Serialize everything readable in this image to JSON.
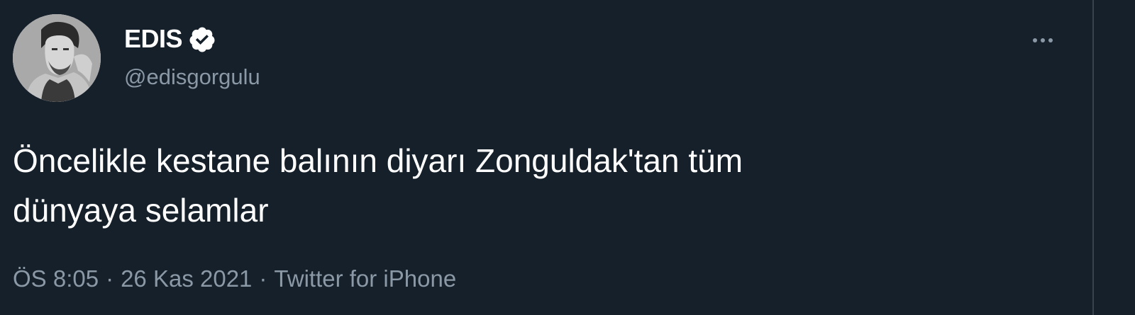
{
  "author": {
    "display_name": "EDIS",
    "handle": "@edisgorgulu",
    "verified": true,
    "avatar_icon": "avatar-photo"
  },
  "tweet": {
    "text_line1": "Öncelikle kestane balının diyarı Zonguldak'tan tüm",
    "text_line2": "dünyaya selamlar",
    "time": "ÖS 8:05",
    "date": "26 Kas 2021",
    "source": "Twitter for iPhone",
    "separator": "·"
  },
  "colors": {
    "background": "#15202b",
    "text": "#ffffff",
    "secondary_text": "#8b98a5",
    "verified_badge": "#ffffff"
  },
  "icons": {
    "more": "more-horizontal-icon",
    "verified": "verified-badge-icon"
  }
}
